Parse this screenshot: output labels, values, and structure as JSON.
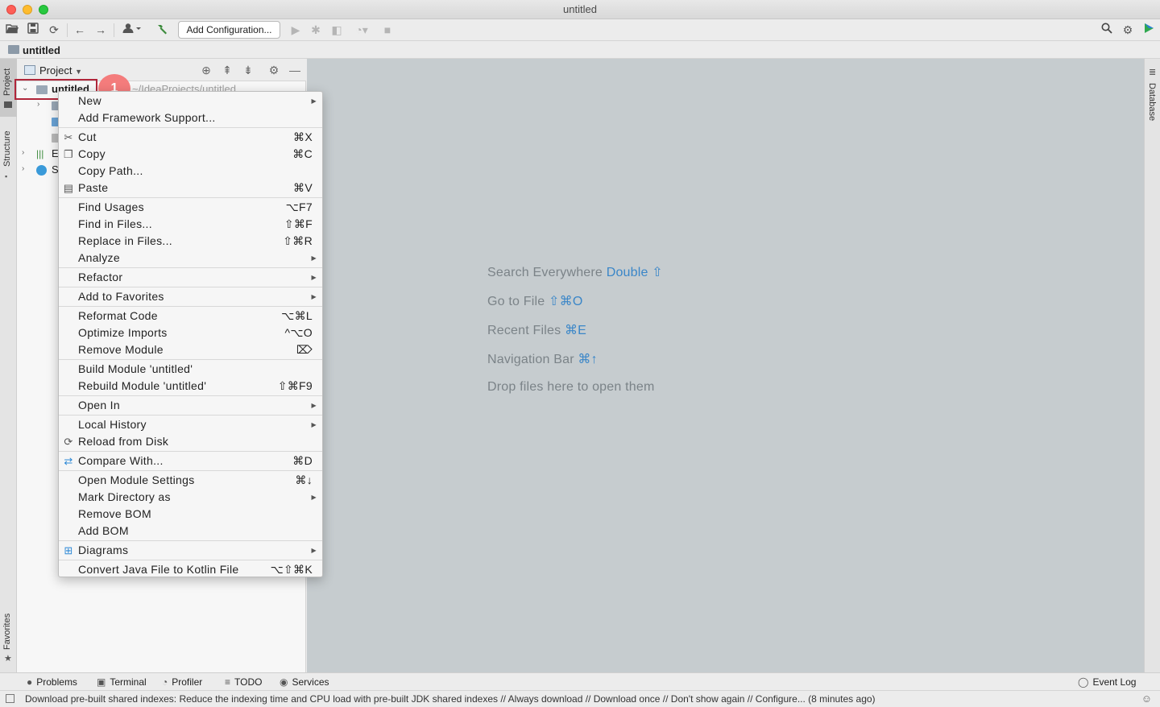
{
  "window": {
    "title": "untitled"
  },
  "toolbar": {
    "add_configuration_label": "Add Configuration...",
    "icons": [
      "open-folder-icon",
      "save-icon",
      "sync-icon",
      "back-icon",
      "forward-icon",
      "user-icon",
      "build-hammer-icon",
      "run-icon",
      "debug-icon",
      "coverage-icon",
      "profile-icon",
      "stop-icon",
      "search-icon",
      "settings-gear-icon",
      "toolbox-icon"
    ]
  },
  "navbar": {
    "project_name": "untitled"
  },
  "left_strip": {
    "tabs": [
      "Project",
      "Structure",
      "Favorites"
    ]
  },
  "right_strip": {
    "tabs": [
      "Database"
    ]
  },
  "project_panel": {
    "title": "Project",
    "tree": {
      "root_label": "untitled",
      "root_path": "~/IdeaProjects/untitled",
      "external_libraries_initial": "E",
      "scratches_initial": "S"
    }
  },
  "annotation": {
    "step_number": "1"
  },
  "editor_hints": {
    "search_everywhere": {
      "text": "Search Everywhere",
      "key": "Double ⇧"
    },
    "go_to_file": {
      "text": "Go to File",
      "key": "⇧⌘O"
    },
    "recent_files": {
      "text": "Recent Files",
      "key": "⌘E"
    },
    "navigation_bar": {
      "text": "Navigation Bar",
      "key": "⌘↑"
    },
    "drop_files": "Drop files here to open them"
  },
  "context_menu": {
    "items": [
      {
        "label": "New",
        "shortcut": "",
        "submenu": true
      },
      {
        "label": "Add Framework Support...",
        "shortcut": ""
      },
      {
        "label": "Cut",
        "shortcut": "⌘X",
        "icon": "scissors-icon"
      },
      {
        "label": "Copy",
        "shortcut": "⌘C",
        "icon": "copy-icon"
      },
      {
        "label": "Copy Path...",
        "shortcut": ""
      },
      {
        "label": "Paste",
        "shortcut": "⌘V",
        "icon": "clipboard-icon"
      },
      {
        "label": "Find Usages",
        "shortcut": "⌥F7"
      },
      {
        "label": "Find in Files...",
        "shortcut": "⇧⌘F"
      },
      {
        "label": "Replace in Files...",
        "shortcut": "⇧⌘R"
      },
      {
        "label": "Analyze",
        "shortcut": "",
        "submenu": true
      },
      {
        "label": "Refactor",
        "shortcut": "",
        "submenu": true
      },
      {
        "label": "Add to Favorites",
        "shortcut": "",
        "submenu": true
      },
      {
        "label": "Reformat Code",
        "shortcut": "⌥⌘L"
      },
      {
        "label": "Optimize Imports",
        "shortcut": "^⌥O"
      },
      {
        "label": "Remove Module",
        "shortcut": "⌦"
      },
      {
        "label": "Build Module 'untitled'",
        "shortcut": ""
      },
      {
        "label": "Rebuild Module 'untitled'",
        "shortcut": "⇧⌘F9"
      },
      {
        "label": "Open In",
        "shortcut": "",
        "submenu": true
      },
      {
        "label": "Local History",
        "shortcut": "",
        "submenu": true
      },
      {
        "label": "Reload from Disk",
        "shortcut": "",
        "icon": "reload-icon"
      },
      {
        "label": "Compare With...",
        "shortcut": "⌘D",
        "icon": "compare-icon"
      },
      {
        "label": "Open Module Settings",
        "shortcut": "⌘↓"
      },
      {
        "label": "Mark Directory as",
        "shortcut": "",
        "submenu": true
      },
      {
        "label": "Remove BOM",
        "shortcut": ""
      },
      {
        "label": "Add BOM",
        "shortcut": ""
      },
      {
        "label": "Diagrams",
        "shortcut": "",
        "submenu": true,
        "icon": "diagram-icon"
      },
      {
        "label": "Convert Java File to Kotlin File",
        "shortcut": "⌥⇧⌘K"
      }
    ]
  },
  "bottom_bar": {
    "problems": "Problems",
    "terminal": "Terminal",
    "profiler": "Profiler",
    "todo": "TODO",
    "services": "Services",
    "event_log": "Event Log"
  },
  "status_bar": {
    "message": "Download pre-built shared indexes: Reduce the indexing time and CPU load with pre-built JDK shared indexes // Always download // Download once // Don't show again // Configure... (8 minutes ago)"
  }
}
